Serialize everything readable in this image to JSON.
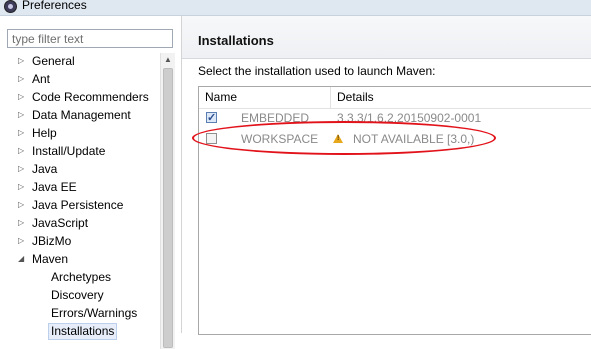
{
  "window": {
    "title": "Preferences"
  },
  "filter": {
    "placeholder": "type filter text",
    "value": ""
  },
  "tree": {
    "items": [
      {
        "label": "General",
        "expanded": false
      },
      {
        "label": "Ant",
        "expanded": false
      },
      {
        "label": "Code Recommenders",
        "expanded": false
      },
      {
        "label": "Data Management",
        "expanded": false
      },
      {
        "label": "Help",
        "expanded": false
      },
      {
        "label": "Install/Update",
        "expanded": false
      },
      {
        "label": "Java",
        "expanded": false
      },
      {
        "label": "Java EE",
        "expanded": false
      },
      {
        "label": "Java Persistence",
        "expanded": false
      },
      {
        "label": "JavaScript",
        "expanded": false
      },
      {
        "label": "JBizMo",
        "expanded": false
      },
      {
        "label": "Maven",
        "expanded": true
      }
    ],
    "maven_children": [
      {
        "label": "Archetypes"
      },
      {
        "label": "Discovery"
      },
      {
        "label": "Errors/Warnings"
      },
      {
        "label": "Installations",
        "selected": true
      }
    ]
  },
  "page": {
    "title": "Installations",
    "instruction": "Select the installation used to launch Maven:",
    "table": {
      "columns": [
        "Name",
        "Details"
      ],
      "rows": [
        {
          "checked": true,
          "name": "EMBEDDED",
          "details": "3.3.3/1.6.2.20150902-0001",
          "warning": false
        },
        {
          "checked": false,
          "name": "WORKSPACE",
          "details": "NOT AVAILABLE [3.0,)",
          "warning": true
        }
      ]
    }
  },
  "colors": {
    "highlight": "#e2121a",
    "warning": "#e8a81b",
    "selection": "#e7eef9"
  }
}
